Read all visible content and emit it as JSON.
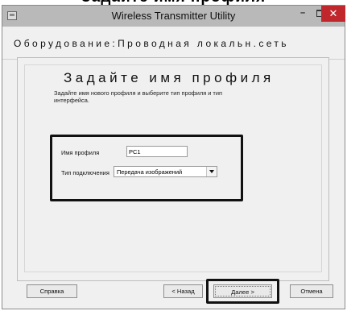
{
  "page": {
    "heading": "Задайте имя профиля"
  },
  "window": {
    "title": "Wireless Transmitter Utility",
    "minimize_label": "–",
    "close_label": "✕",
    "icon": "app-icon"
  },
  "section": {
    "title": "Оборудование:Проводная локальн.сеть"
  },
  "wizard": {
    "title": "Задайте имя профиля",
    "description": "Задайте имя нового профиля и выберите тип профиля и тип интерфейса."
  },
  "form": {
    "profile_name_label": "Имя профиля",
    "profile_name_value": "PC1",
    "connection_type_label": "Тип подключения",
    "connection_type_value": "Передача изображений",
    "dropdown_icon": "chevron-down-icon"
  },
  "buttons": {
    "help": "Справка",
    "back": "< Назад",
    "next": "Далее >",
    "cancel": "Отмена"
  },
  "colors": {
    "titlebar": "#b9b9b9",
    "close_button": "#c0272d",
    "window_background": "#f0f0f0"
  }
}
